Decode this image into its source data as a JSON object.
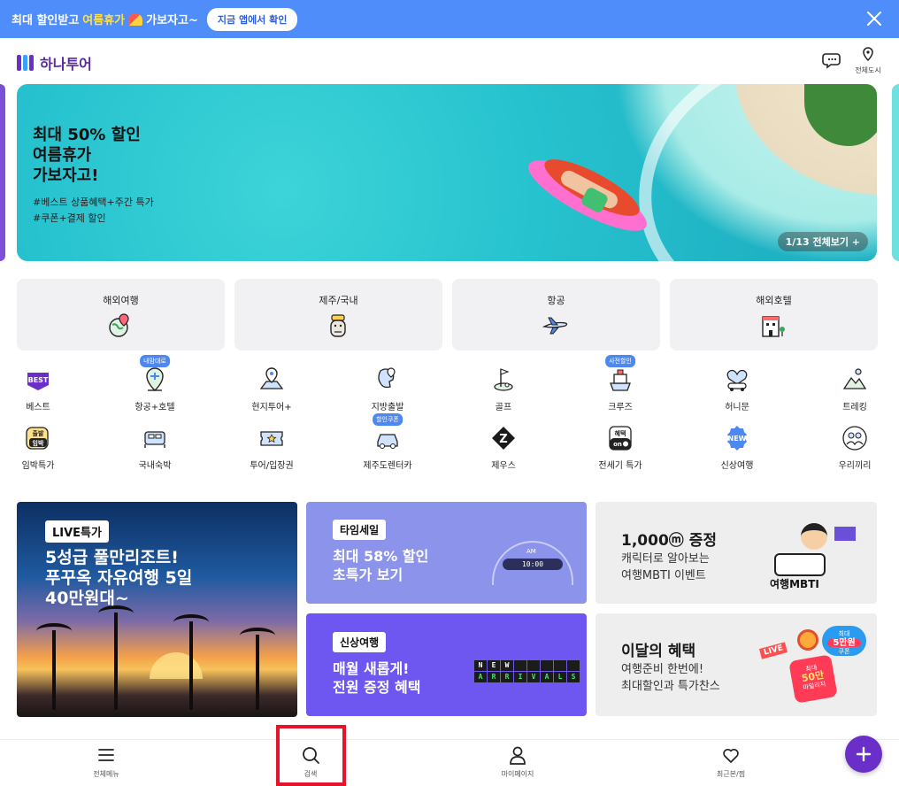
{
  "promo_bar": {
    "text_before": "최대 할인받고",
    "highlight": "여름휴가",
    "text_after": "가보자고~",
    "button": "지금 앱에서 확인"
  },
  "header": {
    "logo": "하나투어",
    "city_label": "전체도시"
  },
  "hero": {
    "title": "최대 50% 할인\n여름휴가\n가보자고!",
    "subtitle_1": "#베스트 상품혜택+주간 특가",
    "subtitle_2": "#쿠폰+결제 할인",
    "counter": "1/13 전체보기 +"
  },
  "categories": [
    {
      "label": "해외여행",
      "icon": "globe-pin-icon"
    },
    {
      "label": "제주/국내",
      "icon": "dol-hareubang-icon"
    },
    {
      "label": "항공",
      "icon": "airplane-icon"
    },
    {
      "label": "해외호텔",
      "icon": "hotel-icon"
    }
  ],
  "shortcuts_row1": [
    {
      "label": "베스트",
      "badge": "",
      "icon": "best-icon"
    },
    {
      "label": "항공+호텔",
      "badge": "내맘대로",
      "icon": "air-hotel-icon"
    },
    {
      "label": "현지투어+",
      "badge": "",
      "icon": "local-tour-icon"
    },
    {
      "label": "지방출발",
      "badge": "",
      "icon": "regional-departure-icon"
    },
    {
      "label": "골프",
      "badge": "",
      "icon": "golf-icon"
    },
    {
      "label": "크루즈",
      "badge": "사전할인",
      "icon": "cruise-icon"
    },
    {
      "label": "허니문",
      "badge": "",
      "icon": "honeymoon-icon"
    },
    {
      "label": "트레킹",
      "badge": "",
      "icon": "trekking-icon"
    }
  ],
  "shortcuts_row2": [
    {
      "label": "임박특가",
      "badge": "",
      "icon": "last-minute-icon"
    },
    {
      "label": "국내숙박",
      "badge": "",
      "icon": "domestic-stay-icon"
    },
    {
      "label": "투어/입장권",
      "badge": "",
      "icon": "ticket-icon"
    },
    {
      "label": "제주도렌터카",
      "badge": "할인쿠폰",
      "icon": "rental-car-icon"
    },
    {
      "label": "제우스",
      "badge": "",
      "icon": "zeus-icon"
    },
    {
      "label": "전세기 특가",
      "badge": "",
      "icon": "charter-icon"
    },
    {
      "label": "신상여행",
      "badge": "",
      "icon": "new-icon"
    },
    {
      "label": "우리끼리",
      "badge": "",
      "icon": "group-icon"
    }
  ],
  "tiles": {
    "live": {
      "tag": "LIVE특가",
      "text": "5성급 풀만리조트!\n푸꾸옥 자유여행 5일\n40만원대~"
    },
    "timesale": {
      "tag": "타임세일",
      "text": "최대 58% 할인\n초특가 보기",
      "clock_am": "AM",
      "clock_digits": "10:00"
    },
    "new": {
      "tag": "신상여행",
      "text": "매월 새롭게!\n전원 증정 혜택"
    },
    "mbti": {
      "title": "1,000ⓜ 증정",
      "text": "캐릭터로 알아보는\n여행MBTI 이벤트",
      "art_word": "여행MBTI"
    },
    "benefit": {
      "title": "이달의 혜택",
      "text": "여행준비 한번에!\n최대할인과 특가찬스",
      "live": "LIVE",
      "coupon_top": "최대",
      "coupon_amount": "50만",
      "coupon_bottom": "마일리지",
      "badge_top": "최대",
      "badge_amount": "5만원",
      "badge_bottom": "쿠폰"
    }
  },
  "arrivals": [
    "N",
    "E",
    "W",
    " ",
    " ",
    " ",
    " ",
    " ",
    "A",
    "R",
    "R",
    "I",
    "V",
    "A",
    "L",
    "S"
  ],
  "bottom_nav": {
    "menu": "전체메뉴",
    "search": "검색",
    "mypage": "마이페이지",
    "recent": "최근본/찜"
  },
  "colors": {
    "promo_bg": "#4f8dfa",
    "brand_purple": "#6b2fc9",
    "highlight_border": "#e4152b"
  }
}
